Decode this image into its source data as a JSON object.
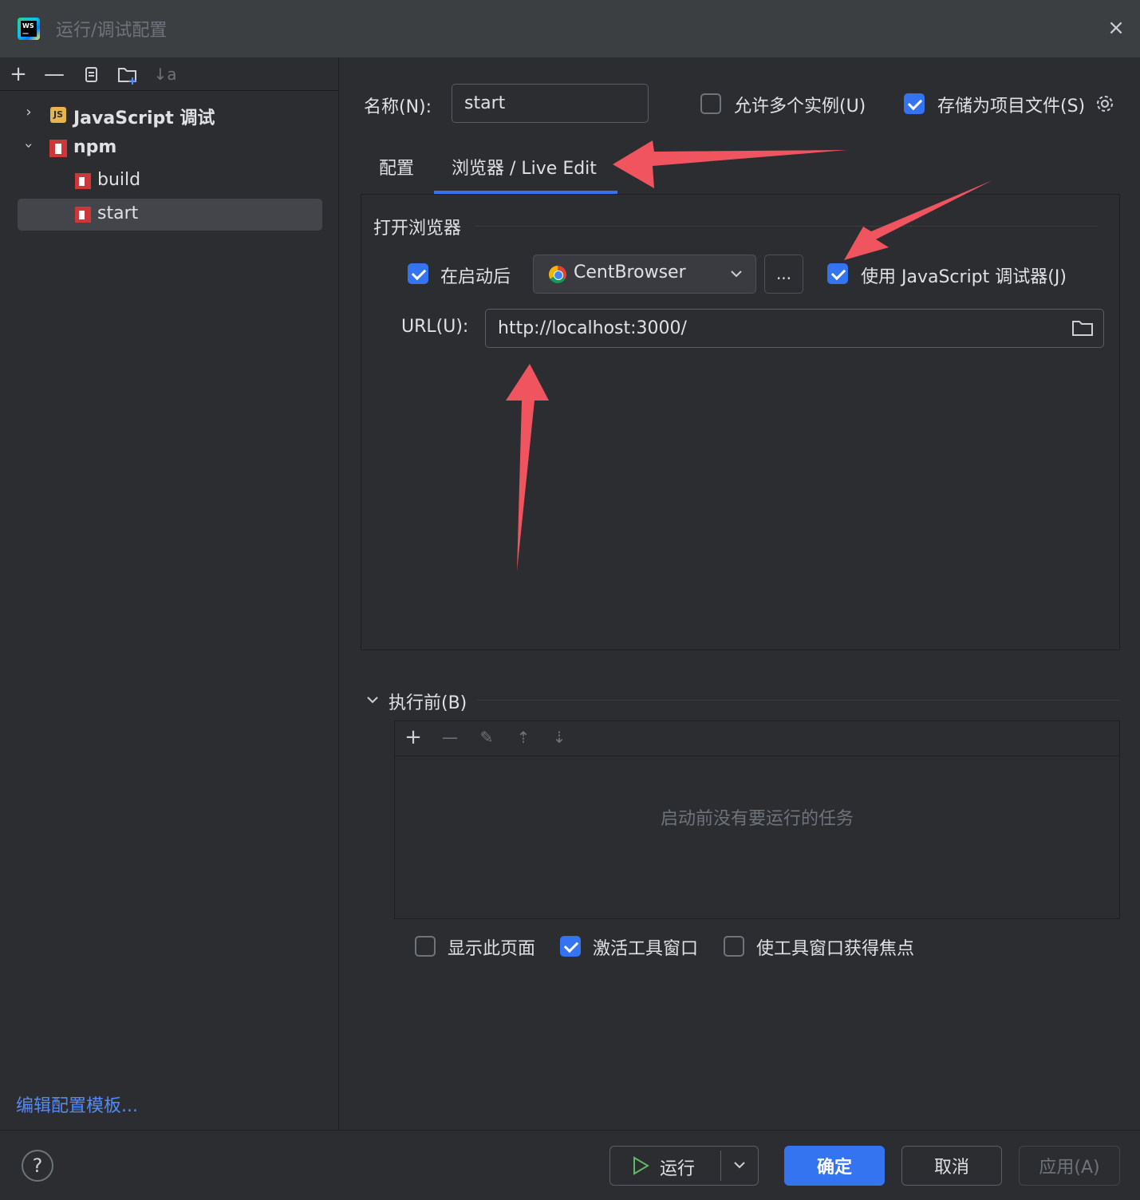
{
  "window": {
    "title": "运行/调试配置",
    "close_icon": "×"
  },
  "left": {
    "toolbar": [
      {
        "name": "add-icon",
        "glyph": "+"
      },
      {
        "name": "remove-icon",
        "glyph": "—"
      },
      {
        "name": "copy-icon",
        "glyph": "⎘"
      },
      {
        "name": "new-folder-icon",
        "glyph": "🗀"
      },
      {
        "name": "sort-icon",
        "glyph": "↓a"
      }
    ],
    "tree": [
      {
        "label": "JavaScript 调试",
        "expanded": false
      },
      {
        "label": "npm",
        "expanded": true
      },
      {
        "label": "build"
      },
      {
        "label": "start",
        "selected": true
      }
    ],
    "edit_templates": "编辑配置模板..."
  },
  "form": {
    "name_label": "名称(N):",
    "name_value": "start",
    "allow_multiple_label": "允许多个实例(U)",
    "allow_multiple_checked": false,
    "store_as_file_label": "存储为项目文件(S)",
    "store_as_file_checked": true
  },
  "tabs": [
    {
      "label": "配置",
      "active": false
    },
    {
      "label": "浏览器 / Live Edit",
      "active": true
    }
  ],
  "browser": {
    "group_title": "打开浏览器",
    "after_launch_label": "在启动后",
    "after_launch_checked": true,
    "browser_value": "CentBrowser",
    "ellipsis": "...",
    "use_js_debugger_label": "使用 JavaScript 调试器(J)",
    "use_js_debugger_checked": true,
    "url_label": "URL(U):",
    "url_value": "http://localhost:3000/"
  },
  "before_launch": {
    "title": "执行前(B)",
    "toolbar": [
      "+",
      "—",
      "✎",
      "⇡",
      "⇣"
    ],
    "empty_text": "启动前没有要运行的任务",
    "show_page_label": "显示此页面",
    "show_page_checked": false,
    "activate_tool_label": "激活工具窗口",
    "activate_tool_checked": true,
    "focus_tool_label": "使工具窗口获得焦点",
    "focus_tool_checked": false
  },
  "footer": {
    "help": "?",
    "run_label": "运行",
    "ok_label": "确定",
    "cancel_label": "取消",
    "apply_label": "应用(A)"
  },
  "colors": {
    "accent": "#3574f0",
    "annotation": "#f0545e",
    "link": "#548af7"
  }
}
